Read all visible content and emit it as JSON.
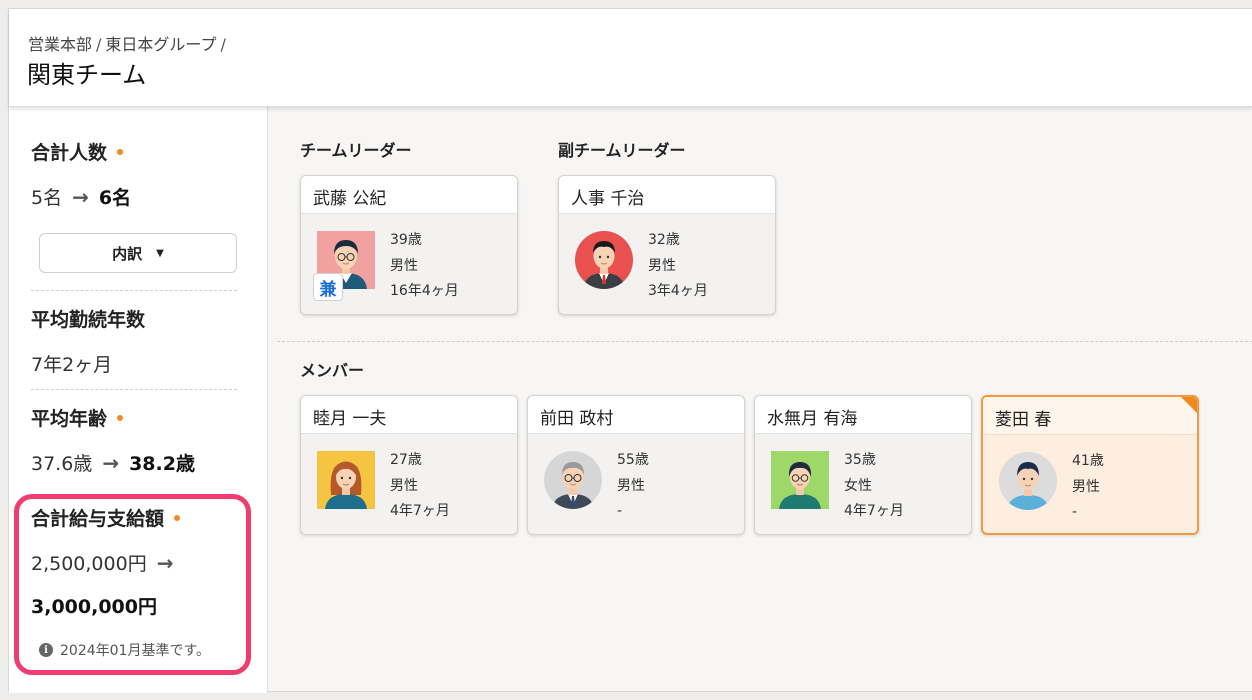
{
  "breadcrumb": [
    "営業本部",
    "東日本グループ"
  ],
  "breadcrumb_separator": "/",
  "page_title": "関東チーム",
  "sidebar": {
    "headcount": {
      "title": "合計人数",
      "from": "5名",
      "to": "6名",
      "button_label": "内訳"
    },
    "avg_tenure": {
      "title": "平均勤続年数",
      "value": "7年2ヶ月"
    },
    "avg_age": {
      "title": "平均年齢",
      "from": "37.6歳",
      "to": "38.2歳"
    },
    "total_salary": {
      "title": "合計給与支給額",
      "from": "2,500,000円",
      "to": "3,000,000円",
      "note": "2024年01月基準です。"
    }
  },
  "sections": {
    "leader": "チームリーダー",
    "sub_leader": "副チームリーダー",
    "members": "メンバー"
  },
  "leader": {
    "name": "武藤 公紀",
    "age": "39歳",
    "gender": "男性",
    "tenure": "16年4ヶ月",
    "badge": "兼"
  },
  "sub_leader": {
    "name": "人事 千治",
    "age": "32歳",
    "gender": "男性",
    "tenure": "3年4ヶ月"
  },
  "members": [
    {
      "name": "睦月 一夫",
      "age": "27歳",
      "gender": "男性",
      "tenure": "4年7ヶ月"
    },
    {
      "name": "前田 政村",
      "age": "55歳",
      "gender": "男性",
      "tenure": "-"
    },
    {
      "name": "水無月 有海",
      "age": "35歳",
      "gender": "女性",
      "tenure": "4年7ヶ月"
    },
    {
      "name": "菱田 春",
      "age": "41歳",
      "gender": "男性",
      "tenure": "-"
    }
  ],
  "colors": {
    "accent_dot": "#f08a1e",
    "highlight": "#ef3d74",
    "badge_text": "#1e6fd0",
    "selected_border": "#f09a44"
  },
  "icons": {
    "arrow": "arrow-right-icon",
    "info": "info-circle-icon",
    "caret": "caret-down-icon"
  }
}
